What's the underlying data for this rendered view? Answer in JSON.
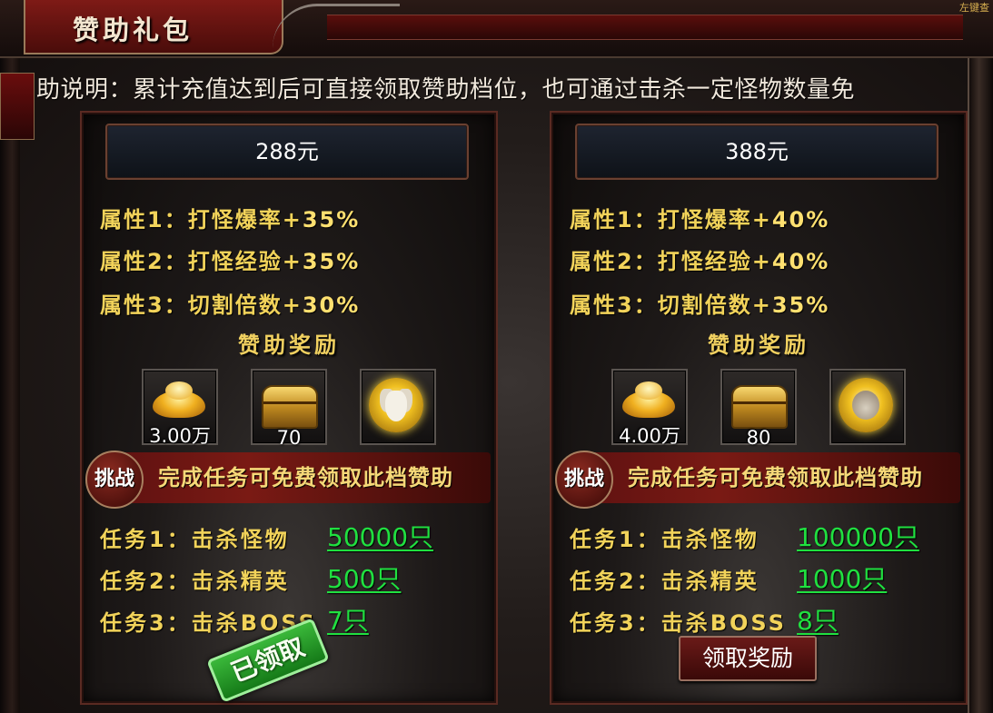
{
  "header": {
    "title": "赞助礼包",
    "corner_text": "左键查"
  },
  "description": "助说明：累计充值达到后可直接领取赞助档位，也可通过击杀一定怪物数量免",
  "tiers": [
    {
      "price": "288元",
      "attributes": [
        {
          "label": "属性1：打怪爆率+",
          "value": "35%"
        },
        {
          "label": "属性2：打怪经验+",
          "value": "35%"
        },
        {
          "label": "属性3：切割倍数+",
          "value": "30%"
        }
      ],
      "reward_title": "赞助奖励",
      "rewards": [
        {
          "icon": "gold-ingot-icon",
          "qty": "3.00万"
        },
        {
          "icon": "treasure-chest-icon",
          "qty": "70"
        },
        {
          "icon": "goat-zodiac-badge-icon",
          "qty": ""
        }
      ],
      "challenge_badge": "挑战",
      "challenge_text": "完成任务可免费领取此档赞助",
      "tasks": [
        {
          "label": "任务1：击杀怪物",
          "value": "50000只"
        },
        {
          "label": "任务2：击杀精英",
          "value": "500只"
        },
        {
          "label": "任务3：击杀BOSS",
          "value": "7只"
        }
      ],
      "status": "已领取"
    },
    {
      "price": "388元",
      "attributes": [
        {
          "label": "属性1：打怪爆率+",
          "value": "40%"
        },
        {
          "label": "属性2：打怪经验+",
          "value": "40%"
        },
        {
          "label": "属性3：切割倍数+",
          "value": "35%"
        }
      ],
      "reward_title": "赞助奖励",
      "rewards": [
        {
          "icon": "gold-ingot-icon",
          "qty": "4.00万"
        },
        {
          "icon": "treasure-chest-icon",
          "qty": "80"
        },
        {
          "icon": "monkey-zodiac-badge-icon",
          "qty": ""
        }
      ],
      "challenge_badge": "挑战",
      "challenge_text": "完成任务可免费领取此档赞助",
      "tasks": [
        {
          "label": "任务1：击杀怪物",
          "value": "100000只"
        },
        {
          "label": "任务2：击杀精英",
          "value": "1000只"
        },
        {
          "label": "任务3：击杀BOSS",
          "value": "8只"
        }
      ],
      "claim_button": "领取奖励"
    }
  ]
}
